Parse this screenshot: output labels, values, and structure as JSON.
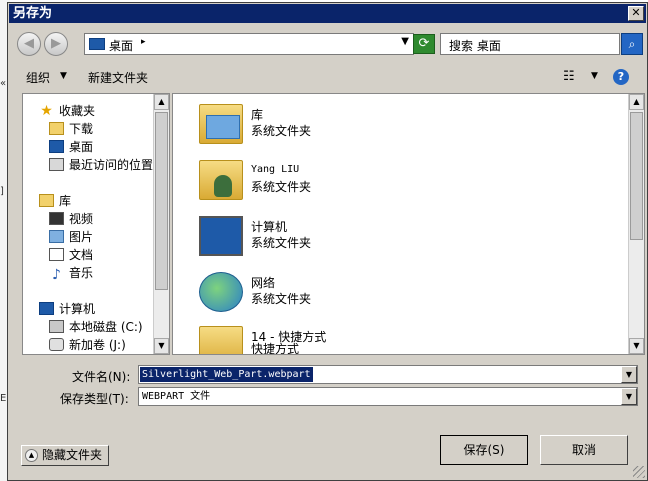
{
  "window": {
    "title": "另存为",
    "close_label": "✕"
  },
  "nav": {
    "back_icon": "back-arrow-icon",
    "forward_icon": "forward-arrow-icon",
    "address": "桌面",
    "address_chevron": "▸",
    "address_dropdown": "▼",
    "search_placeholder": "搜索 桌面"
  },
  "toolbar": {
    "organize": "组织",
    "organize_arrow": "▼",
    "new_folder": "新建文件夹",
    "view_arrow": "▼",
    "help": "?"
  },
  "sidebar": {
    "groups": [
      {
        "label": "收藏夹",
        "icon": "star-icon",
        "items": [
          {
            "label": "下载",
            "icon": "downloads-icon"
          },
          {
            "label": "桌面",
            "icon": "desktop-icon"
          },
          {
            "label": "最近访问的位置",
            "icon": "recent-places-icon"
          }
        ]
      },
      {
        "label": "库",
        "icon": "library-icon",
        "items": [
          {
            "label": "视频",
            "icon": "video-icon"
          },
          {
            "label": "图片",
            "icon": "pictures-icon"
          },
          {
            "label": "文档",
            "icon": "documents-icon"
          },
          {
            "label": "音乐",
            "icon": "music-icon"
          }
        ]
      },
      {
        "label": "计算机",
        "icon": "computer-icon",
        "items": [
          {
            "label": "本地磁盘 (C:)",
            "icon": "local-disk-icon"
          },
          {
            "label": "新加卷 (J:)",
            "icon": "new-volume-icon"
          }
        ]
      }
    ]
  },
  "content": {
    "items": [
      {
        "name": "库",
        "type": "系统文件夹",
        "icon": "library-folder-icon"
      },
      {
        "name": "Yang LIU",
        "type": "系统文件夹",
        "icon": "user-folder-icon"
      },
      {
        "name": "计算机",
        "type": "系统文件夹",
        "icon": "computer-icon"
      },
      {
        "name": "网络",
        "type": "系统文件夹",
        "icon": "network-icon"
      },
      {
        "name": "14 - 快捷方式",
        "type": "快捷方式",
        "icon": "shortcut-folder-icon"
      }
    ]
  },
  "form": {
    "filename_label": "文件名(N):",
    "filename_value": "Silverlight_Web_Part.webpart",
    "filetype_label": "保存类型(T):",
    "filetype_value": "WEBPART 文件"
  },
  "buttons": {
    "save": "保存(S)",
    "cancel": "取消",
    "hide_folders": "隐藏文件夹"
  },
  "background": {
    "left_edge_texts": [
      "«",
      "]",
      "EN"
    ]
  }
}
